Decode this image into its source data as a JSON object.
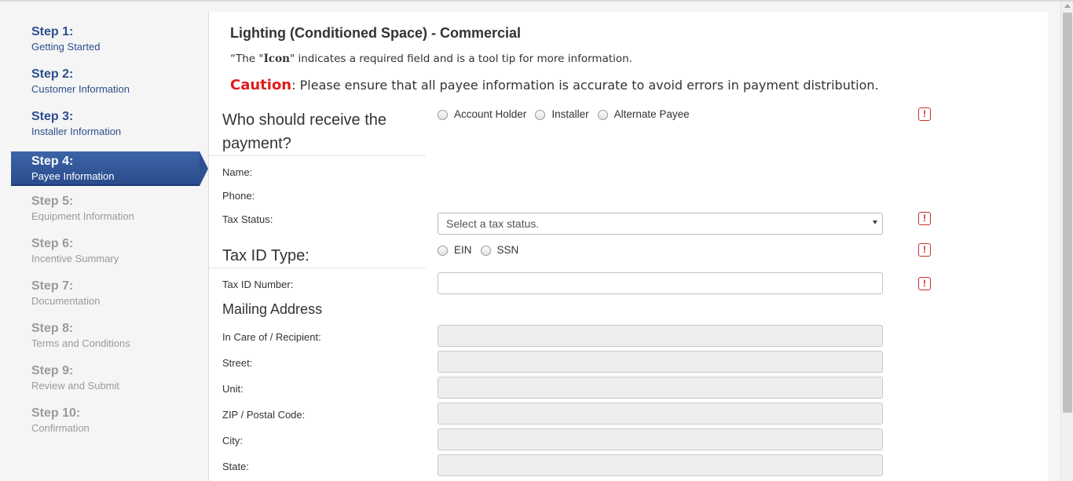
{
  "steps": [
    {
      "num": "Step 1:",
      "label": "Getting Started"
    },
    {
      "num": "Step 2:",
      "label": "Customer Information"
    },
    {
      "num": "Step 3:",
      "label": "Installer Information"
    },
    {
      "num": "Step 4:",
      "label": "Payee Information"
    },
    {
      "num": "Step 5:",
      "label": "Equipment Information"
    },
    {
      "num": "Step 6:",
      "label": "Incentive Summary"
    },
    {
      "num": "Step 7:",
      "label": "Documentation"
    },
    {
      "num": "Step 8:",
      "label": "Terms and Conditions"
    },
    {
      "num": "Step 9:",
      "label": "Review and Submit"
    },
    {
      "num": "Step 10:",
      "label": "Confirmation"
    }
  ],
  "page": {
    "title": "Lighting (Conditioned Space) - Commercial",
    "note_prefix": "“The \"",
    "note_icon": "Icon",
    "note_suffix": "\" indicates a required field and is a tool tip for more information.",
    "caution_word": "Caution",
    "caution_text": ": Please ensure that all payee information is accurate to avoid errors in payment distribution."
  },
  "payment": {
    "question_line1": "Who should receive the",
    "question_line2": "payment?",
    "options": [
      "Account Holder",
      "Installer",
      "Alternate Payee"
    ]
  },
  "fields": {
    "name_label": "Name:",
    "phone_label": "Phone:",
    "tax_status_label": "Tax Status:",
    "tax_status_placeholder": "Select a tax status.",
    "tax_id_type_heading": "Tax ID Type:",
    "tax_id_options": [
      "EIN",
      "SSN"
    ],
    "tax_id_number_label": "Tax ID Number:",
    "tax_id_number_value": ""
  },
  "mailing": {
    "heading": "Mailing Address",
    "labels": {
      "care_of": "In Care of / Recipient:",
      "street": "Street:",
      "unit": "Unit:",
      "zip": "ZIP / Postal Code:",
      "city": "City:",
      "state": "State:"
    }
  },
  "required_icon": "!",
  "colors": {
    "step_done": "#2c4f8e",
    "step_active_bg": "#2e5090",
    "step_todo": "#9a9a9a",
    "caution": "#e01b1b",
    "required_icon": "#c9302c"
  }
}
